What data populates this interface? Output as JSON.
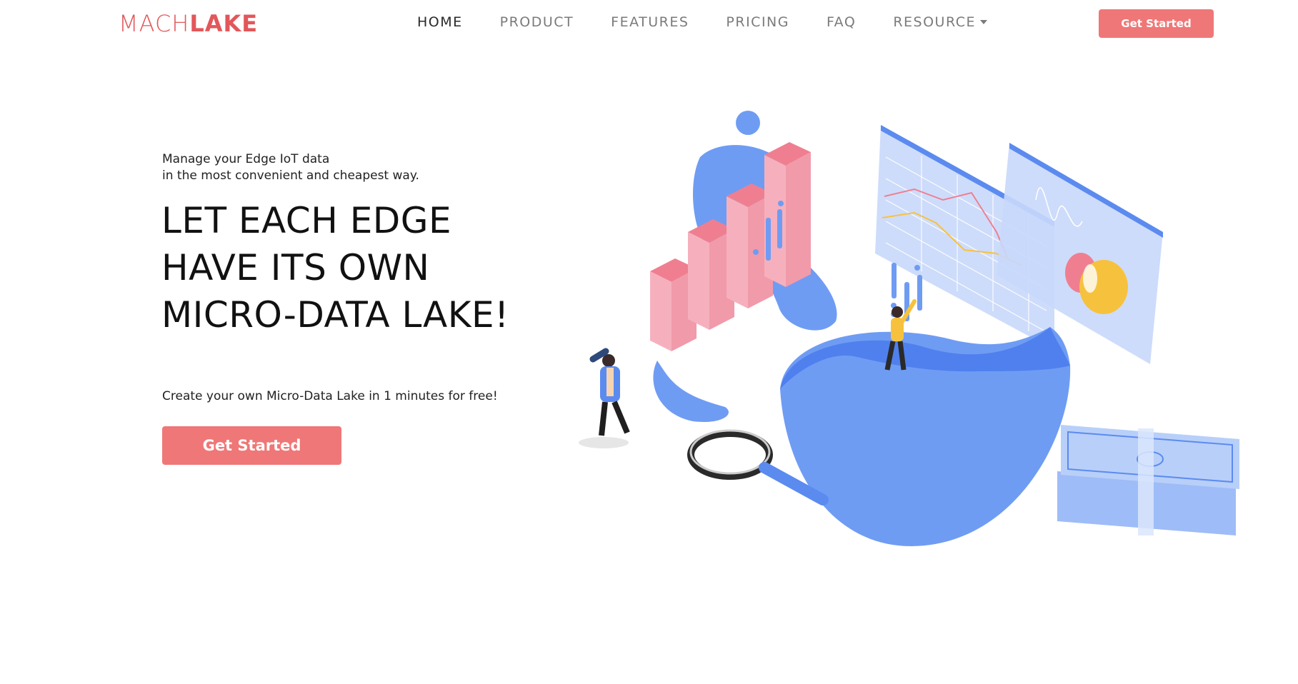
{
  "brand": {
    "logo_part1": "MACH",
    "logo_part2": "LAKE",
    "color": "#e2575a"
  },
  "nav": {
    "items": [
      {
        "label": "HOME",
        "active": true
      },
      {
        "label": "PRODUCT",
        "active": false
      },
      {
        "label": "FEATURES",
        "active": false
      },
      {
        "label": "PRICING",
        "active": false
      },
      {
        "label": "FAQ",
        "active": false
      },
      {
        "label": "RESOURCE",
        "active": false,
        "dropdown": true
      }
    ],
    "cta_label": "Get Started"
  },
  "hero": {
    "subtitle_line1": "Manage your Edge IoT data",
    "subtitle_line2": "in the most convenient and cheapest way.",
    "title_line1": "LET EACH EDGE",
    "title_line2": "HAVE ITS OWN",
    "title_line3": "MICRO-DATA LAKE!",
    "cta_text": "Create your own Micro-Data Lake in 1 minutes for free!",
    "cta_label": "Get Started"
  },
  "colors": {
    "accent": "#ef7777",
    "blue": "#6f9cf3",
    "pink": "#f4a5b3",
    "yellow": "#f6c23e"
  },
  "illustration": {
    "icon": "data-lake-illustration"
  }
}
